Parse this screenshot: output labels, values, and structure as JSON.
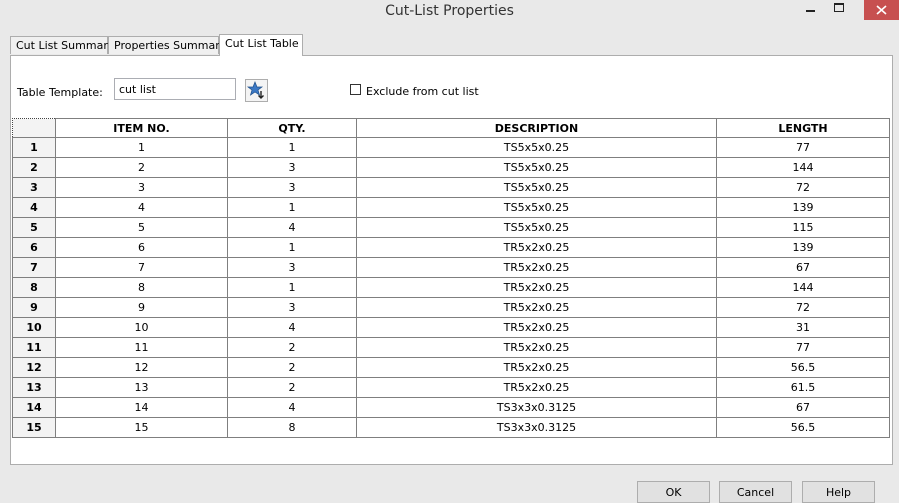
{
  "window": {
    "title": "Cut-List Properties",
    "controls": [
      "minimize-icon",
      "maximize-icon",
      "close-icon"
    ]
  },
  "tabs": [
    {
      "label": "Cut List Summary",
      "active": false
    },
    {
      "label": "Properties Summary",
      "active": false
    },
    {
      "label": "Cut List Table",
      "active": true
    }
  ],
  "template": {
    "label": "Table Template:",
    "value": "cut list",
    "button_icon": "star-arrow-icon"
  },
  "exclude": {
    "label": "Exclude from cut list",
    "checked": false
  },
  "table": {
    "columns": [
      "ITEM NO.",
      "QTY.",
      "DESCRIPTION",
      "LENGTH"
    ],
    "rows": [
      {
        "row": "1",
        "item": "1",
        "qty": "1",
        "desc": "TS5x5x0.25",
        "length": "77"
      },
      {
        "row": "2",
        "item": "2",
        "qty": "3",
        "desc": "TS5x5x0.25",
        "length": "144"
      },
      {
        "row": "3",
        "item": "3",
        "qty": "3",
        "desc": "TS5x5x0.25",
        "length": "72"
      },
      {
        "row": "4",
        "item": "4",
        "qty": "1",
        "desc": "TS5x5x0.25",
        "length": "139"
      },
      {
        "row": "5",
        "item": "5",
        "qty": "4",
        "desc": "TS5x5x0.25",
        "length": "115"
      },
      {
        "row": "6",
        "item": "6",
        "qty": "1",
        "desc": "TR5x2x0.25",
        "length": "139"
      },
      {
        "row": "7",
        "item": "7",
        "qty": "3",
        "desc": "TR5x2x0.25",
        "length": "67"
      },
      {
        "row": "8",
        "item": "8",
        "qty": "1",
        "desc": "TR5x2x0.25",
        "length": "144"
      },
      {
        "row": "9",
        "item": "9",
        "qty": "3",
        "desc": "TR5x2x0.25",
        "length": "72"
      },
      {
        "row": "10",
        "item": "10",
        "qty": "4",
        "desc": "TR5x2x0.25",
        "length": "31"
      },
      {
        "row": "11",
        "item": "11",
        "qty": "2",
        "desc": "TR5x2x0.25",
        "length": "77"
      },
      {
        "row": "12",
        "item": "12",
        "qty": "2",
        "desc": "TR5x2x0.25",
        "length": "56.5"
      },
      {
        "row": "13",
        "item": "13",
        "qty": "2",
        "desc": "TR5x2x0.25",
        "length": "61.5"
      },
      {
        "row": "14",
        "item": "14",
        "qty": "4",
        "desc": "TS3x3x0.3125",
        "length": "67"
      },
      {
        "row": "15",
        "item": "15",
        "qty": "8",
        "desc": "TS3x3x0.3125",
        "length": "56.5"
      }
    ]
  },
  "buttons": {
    "ok": "OK",
    "cancel": "Cancel",
    "help": "Help"
  },
  "colors": {
    "close_button": "#c75050",
    "accent_star": "#3b78c4"
  }
}
